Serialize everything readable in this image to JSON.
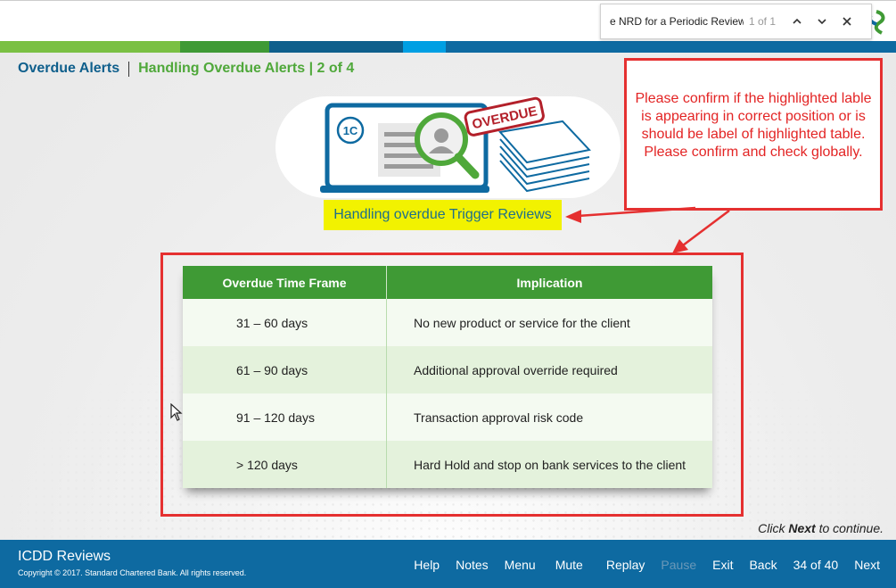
{
  "find_bar": {
    "query": "e NRD for a Periodic Review",
    "match_count": "1 of 1",
    "icons": [
      "chevron-up-icon",
      "chevron-down-icon",
      "close-icon"
    ]
  },
  "header": {
    "brand_colors": [
      "#7ac043",
      "#3f9a35",
      "#0f5f8c",
      "#009fe3",
      "#0e6aa1"
    ]
  },
  "breadcrumb": {
    "section": "Overdue Alerts",
    "page": "Handling Overdue Alerts | 2 of 4"
  },
  "hero": {
    "badge": "OVERDUE",
    "laptop_mark": "1C",
    "caption": "Handling overdue Trigger Reviews"
  },
  "review_note": {
    "text": "Please confirm if the highlighted lable is appearing in correct position or is should be label of highlighted table. Please confirm and check globally."
  },
  "table": {
    "headers": [
      "Overdue Time Frame",
      "Implication"
    ],
    "rows": [
      {
        "time": "31 – 60 days",
        "implication": "No new product or service for the client"
      },
      {
        "time": "61 – 90 days",
        "implication": "Additional approval override required"
      },
      {
        "time": "91 – 120 days",
        "implication": "Transaction approval risk code"
      },
      {
        "time": "> 120 days",
        "implication": "Hard Hold and stop on bank services to the client"
      }
    ]
  },
  "continue_hint": {
    "prefix": "Click",
    "keyword": "Next",
    "suffix": "to continue."
  },
  "footer": {
    "course_title": "ICDD Reviews",
    "copyright": "Copyright © 2017. Standard Chartered Bank. All rights reserved.",
    "nav": {
      "help": "Help",
      "notes": "Notes",
      "menu": "Menu",
      "mute": "Mute",
      "replay": "Replay",
      "pause": "Pause",
      "exit": "Exit",
      "back": "Back",
      "progress": "34 of 40",
      "next": "Next"
    }
  },
  "colors": {
    "footer_bg": "#0e6aa1",
    "table_header": "#3f9a35",
    "annotation_red": "#e53030",
    "highlight_yellow": "#f2f200"
  }
}
